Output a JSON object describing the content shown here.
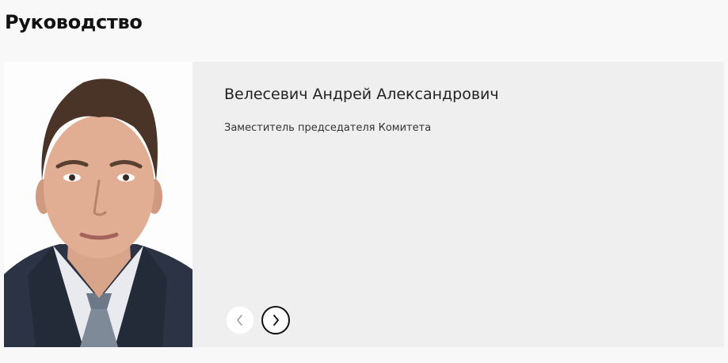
{
  "section": {
    "title": "Руководство"
  },
  "person": {
    "name": "Велесевич Андрей Александрович",
    "position": "Заместитель председателя Комитета",
    "photo_icon": "portrait-photo"
  },
  "carousel": {
    "prev_icon": "chevron-left-icon",
    "next_icon": "chevron-right-icon"
  },
  "colors": {
    "page_background": "#f8f8f8",
    "card_background": "#efefef",
    "title_text": "#111111"
  }
}
